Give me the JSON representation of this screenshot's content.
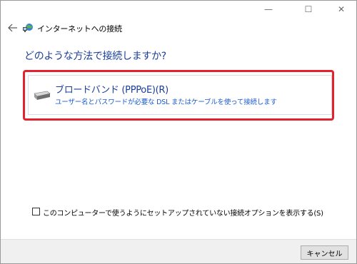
{
  "window": {
    "title": "インターネットへの接続",
    "controls": {
      "minimize": "—",
      "maximize": "☐",
      "close": "✕"
    }
  },
  "nav": {
    "back_icon": "back-arrow-icon",
    "app_icon": "network-connection-icon"
  },
  "main": {
    "heading": "どのような方法で接続しますか?",
    "options": [
      {
        "title": "ブロードバンド (PPPoE)(R)",
        "description": "ユーザー名とパスワードが必要な DSL またはケーブルを使って接続します",
        "icon": "broadband-device-icon",
        "highlighted": true
      }
    ],
    "show_options": {
      "label": "このコンピューターで使うようにセットアップされていない接続オプションを表示する(S)",
      "checked": false
    }
  },
  "footer": {
    "cancel_label": "キャンセル"
  },
  "colors": {
    "heading": "#1a3e9a",
    "description": "#1a5bd0",
    "highlight": "#e2222d",
    "footer_bg": "#f0f0f0"
  }
}
